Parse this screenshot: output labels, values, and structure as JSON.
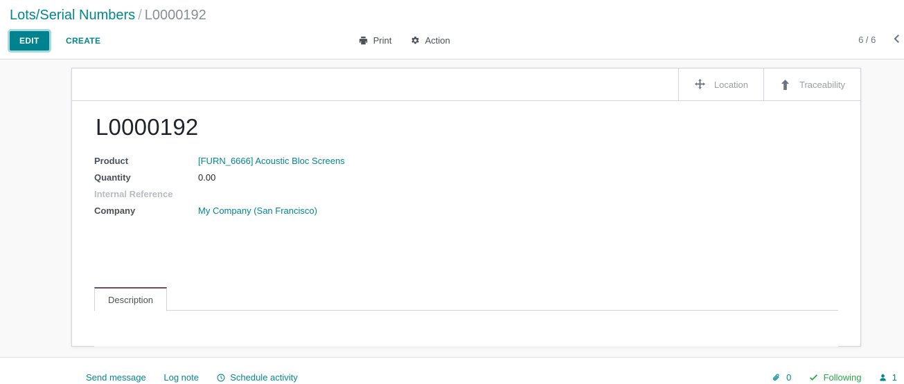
{
  "breadcrumb": {
    "root": "Lots/Serial Numbers",
    "separator": "/",
    "current": "L0000192"
  },
  "control_panel": {
    "edit_label": "EDIT",
    "create_label": "CREATE",
    "print_label": "Print",
    "print_icon": "printer-icon",
    "action_label": "Action",
    "action_icon": "gear-icon",
    "pager_text": "6 / 6",
    "pager_prev_icon": "chevron-left-icon"
  },
  "smart_buttons": [
    {
      "label": "Location",
      "icon": "arrows-move-icon"
    },
    {
      "label": "Traceability",
      "icon": "arrow-up-icon"
    }
  ],
  "record": {
    "title": "L0000192",
    "fields": [
      {
        "label": "Product",
        "value": "[FURN_6666] Acoustic Bloc Screens",
        "is_link": true,
        "empty": false
      },
      {
        "label": "Quantity",
        "value": "0.00",
        "is_link": false,
        "empty": false
      },
      {
        "label": "Internal Reference",
        "value": "",
        "is_link": false,
        "empty": true
      },
      {
        "label": "Company",
        "value": "My Company (San Francisco)",
        "is_link": true,
        "empty": false
      }
    ]
  },
  "notebook": {
    "active_tab": "Description"
  },
  "chatter": {
    "send_message": "Send message",
    "log_note": "Log note",
    "schedule_activity": "Schedule activity",
    "schedule_icon": "clock-icon",
    "attachment_count": "0",
    "attachment_icon": "paperclip-icon",
    "following_label": "Following",
    "following_icon": "check-icon",
    "follower_count": "1",
    "follower_icon": "user-icon"
  },
  "colors": {
    "primary": "#00838f",
    "link": "#00878f",
    "tab_accent": "#714B67",
    "success": "#28a745",
    "muted": "#9a9fa5"
  }
}
